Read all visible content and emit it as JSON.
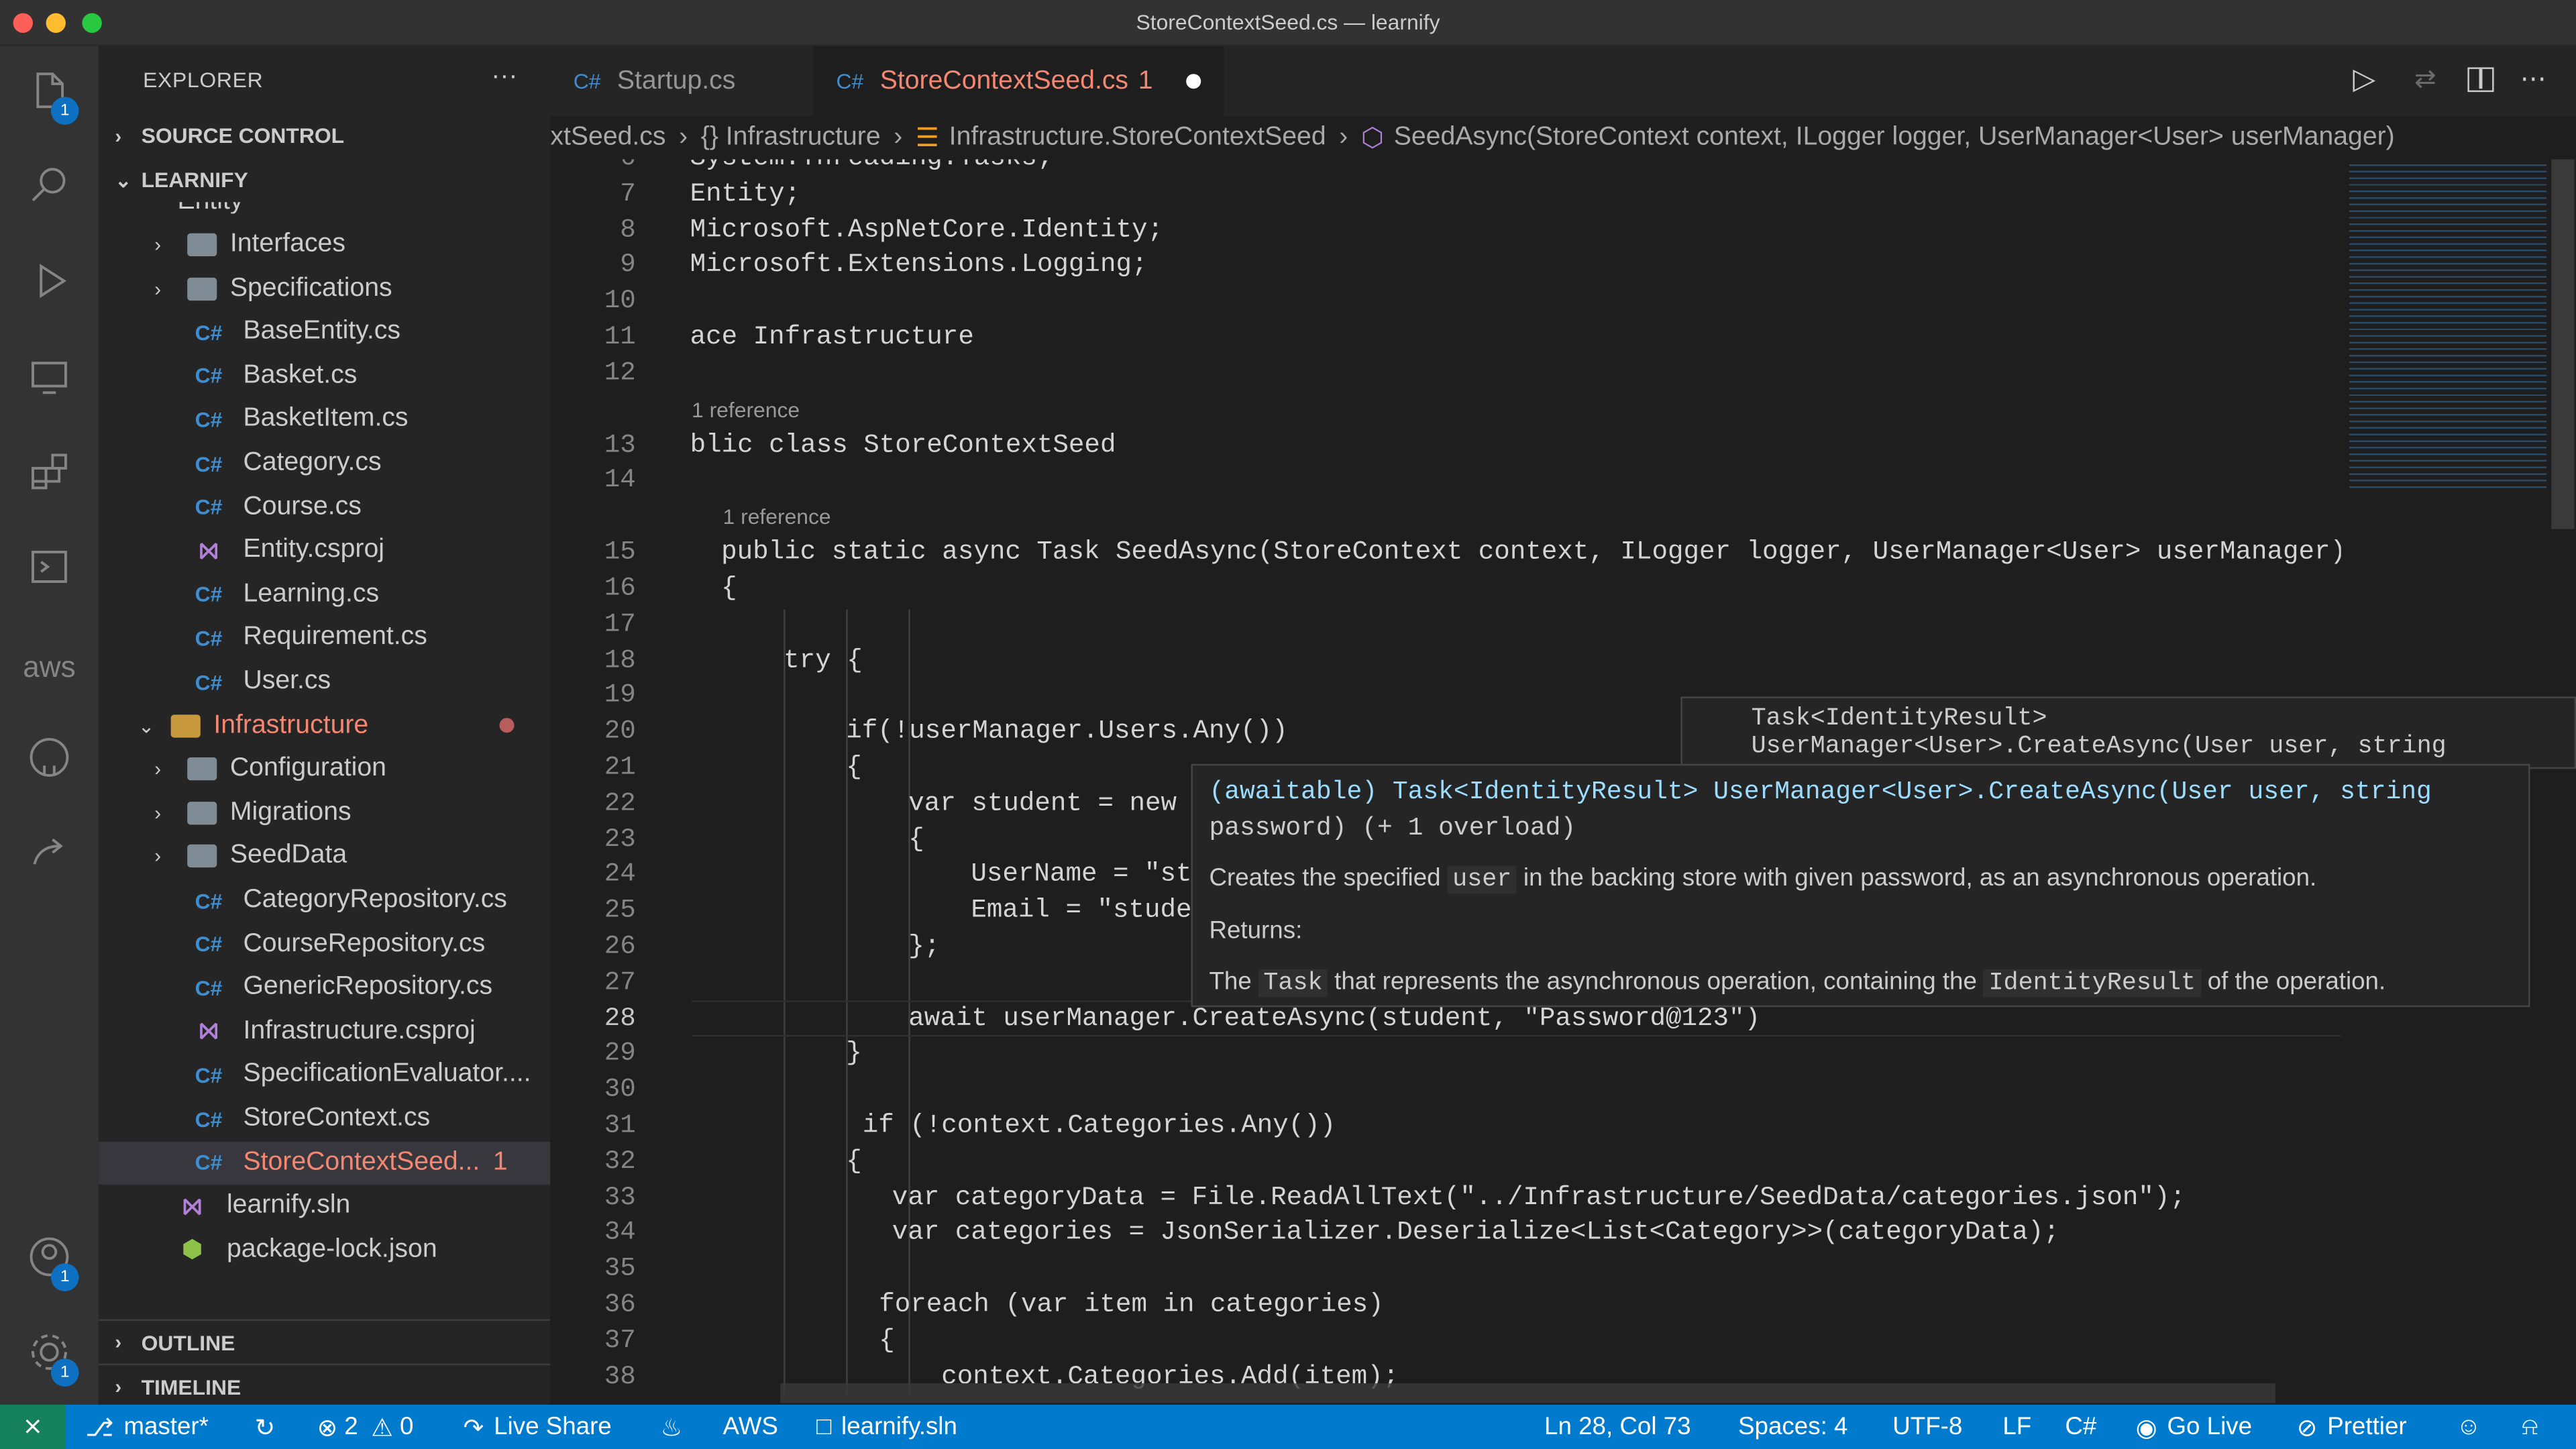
{
  "window": {
    "title": "StoreContextSeed.cs — learnify"
  },
  "activity_bar": {
    "explorer_badge": "1",
    "accounts_badge": "1",
    "settings_badge": "1",
    "aws_label": "aws"
  },
  "sidebar": {
    "title": "EXPLORER",
    "more": "···",
    "source_control": "SOURCE CONTROL",
    "project": "LEARNIFY",
    "partial_top": "Entity",
    "items": [
      {
        "label": "Interfaces",
        "kind": "folder"
      },
      {
        "label": "Specifications",
        "kind": "folder"
      },
      {
        "label": "BaseEntity.cs",
        "kind": "cs"
      },
      {
        "label": "Basket.cs",
        "kind": "cs"
      },
      {
        "label": "BasketItem.cs",
        "kind": "cs"
      },
      {
        "label": "Category.cs",
        "kind": "cs"
      },
      {
        "label": "Course.cs",
        "kind": "cs"
      },
      {
        "label": "Entity.csproj",
        "kind": "csproj"
      },
      {
        "label": "Learning.cs",
        "kind": "cs"
      },
      {
        "label": "Requirement.cs",
        "kind": "cs"
      },
      {
        "label": "User.cs",
        "kind": "cs"
      },
      {
        "label": "Infrastructure",
        "kind": "folder-open"
      },
      {
        "label": "Configuration",
        "kind": "folder"
      },
      {
        "label": "Migrations",
        "kind": "folder"
      },
      {
        "label": "SeedData",
        "kind": "folder"
      },
      {
        "label": "CategoryRepository.cs",
        "kind": "cs"
      },
      {
        "label": "CourseRepository.cs",
        "kind": "cs"
      },
      {
        "label": "GenericRepository.cs",
        "kind": "cs"
      },
      {
        "label": "Infrastructure.csproj",
        "kind": "csproj"
      },
      {
        "label": "SpecificationEvaluator....",
        "kind": "cs"
      },
      {
        "label": "StoreContext.cs",
        "kind": "cs"
      },
      {
        "label": "StoreContextSeed...",
        "kind": "cs",
        "problems": "1"
      },
      {
        "label": "learnify.sln",
        "kind": "sln"
      },
      {
        "label": "package-lock.json",
        "kind": "json"
      }
    ],
    "outline": "OUTLINE",
    "timeline": "TIMELINE"
  },
  "tabs": [
    {
      "label": "Startup.cs",
      "icon": "C#"
    },
    {
      "label": "StoreContextSeed.cs",
      "icon": "C#",
      "problems": "1",
      "modified": true
    }
  ],
  "breadcrumb": {
    "file": "xtSeed.cs",
    "namespace": "{} Infrastructure",
    "class": "Infrastructure.StoreContextSeed",
    "method": "SeedAsync(StoreContext context, ILogger logger, UserManager<User> userManager)"
  },
  "editor": {
    "lens_refs": "1 reference",
    "current_line": "28",
    "lines": [
      {
        "n": "6",
        "text": "System.Threading.Tasks;"
      },
      {
        "n": "7",
        "text": "Entity;"
      },
      {
        "n": "8",
        "text": "Microsoft.AspNetCore.Identity;"
      },
      {
        "n": "9",
        "text": "Microsoft.Extensions.Logging;"
      },
      {
        "n": "10",
        "text": ""
      },
      {
        "n": "11",
        "text": "ace Infrastructure"
      },
      {
        "n": "12",
        "text": ""
      },
      {
        "n": "13",
        "text": "blic class StoreContextSeed"
      },
      {
        "n": "14",
        "text": ""
      },
      {
        "n": "15",
        "text": "public static async Task SeedAsync(StoreContext context, ILogger logger, UserManager<User> userManager)"
      },
      {
        "n": "16",
        "text": "{"
      },
      {
        "n": "17",
        "text": ""
      },
      {
        "n": "18",
        "text": "try {"
      },
      {
        "n": "19",
        "text": ""
      },
      {
        "n": "20",
        "text": "if(!userManager.Users.Any())"
      },
      {
        "n": "21",
        "text": "{"
      },
      {
        "n": "22",
        "text": "var student = new"
      },
      {
        "n": "23",
        "text": "{"
      },
      {
        "n": "24",
        "text": "UserName = \"st"
      },
      {
        "n": "25",
        "text": "Email = \"stude"
      },
      {
        "n": "26",
        "text": "};"
      },
      {
        "n": "27",
        "text": ""
      },
      {
        "n": "28",
        "text": "await userManager.CreateAsync(student, \"Password@123\")"
      },
      {
        "n": "29",
        "text": "}"
      },
      {
        "n": "30",
        "text": ""
      },
      {
        "n": "31",
        "text": "if (!context.Categories.Any())"
      },
      {
        "n": "32",
        "text": "{"
      },
      {
        "n": "33",
        "text": "var categoryData = File.ReadAllText(\"../Infrastructure/SeedData/categories.json\");"
      },
      {
        "n": "34",
        "text": "var categories = JsonSerializer.Deserialize<List<Category>>(categoryData);"
      },
      {
        "n": "35",
        "text": ""
      },
      {
        "n": "36",
        "text": "foreach (var item in categories)"
      },
      {
        "n": "37",
        "text": "{"
      },
      {
        "n": "38",
        "text": "context.Categories.Add(item);"
      }
    ]
  },
  "signature_help": {
    "line1": "Task<IdentityResult>",
    "line2": "UserManager<User>.CreateAsync(User user, string"
  },
  "hover": {
    "signature": "(awaitable) Task<IdentityResult> UserManager<User>.CreateAsync(User user, string",
    "signature2": "password) (+ 1 overload)",
    "desc_pre": "Creates the specified",
    "desc_code": "user",
    "desc_post": "in the backing store with given password, as an asynchronous operation.",
    "returns": "Returns:",
    "ret_pre": "The",
    "ret_code1": "Task",
    "ret_mid": "that represents the asynchronous operation, containing the",
    "ret_code2": "IdentityResult",
    "ret_post": "of the operation."
  },
  "status": {
    "branch": "master*",
    "errors": "2",
    "warnings": "0",
    "live_share": "Live Share",
    "aws": "AWS",
    "solution": "learnify.sln",
    "position": "Ln 28, Col 73",
    "spaces": "Spaces: 4",
    "encoding": "UTF-8",
    "eol": "LF",
    "language": "C#",
    "go_live": "Go Live",
    "prettier": "Prettier"
  },
  "colors": {
    "status_bar": "#007acc",
    "error": "#f48771",
    "keyword": "#569cd6",
    "type": "#4ec9b0",
    "string": "#ce9178"
  }
}
